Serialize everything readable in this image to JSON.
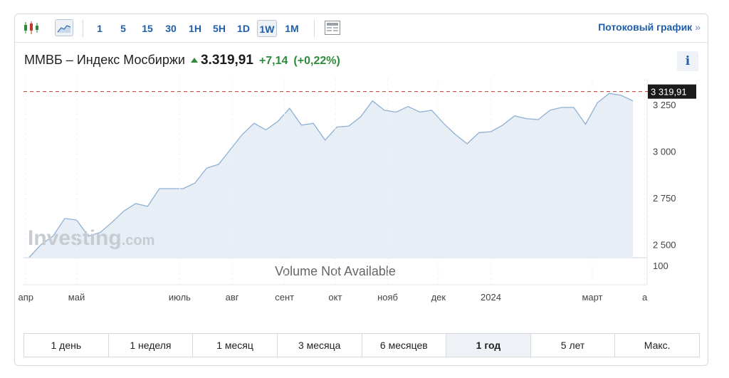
{
  "toolbar": {
    "chart_types": [
      {
        "icon": "candlestick-icon",
        "selected": false
      },
      {
        "icon": "area-chart-icon",
        "selected": true
      }
    ],
    "intervals": [
      {
        "label": "1",
        "selected": false
      },
      {
        "label": "5",
        "selected": false
      },
      {
        "label": "15",
        "selected": false
      },
      {
        "label": "30",
        "selected": false
      },
      {
        "label": "1H",
        "selected": false
      },
      {
        "label": "5H",
        "selected": false
      },
      {
        "label": "1D",
        "selected": false
      },
      {
        "label": "1W",
        "selected": true
      },
      {
        "label": "1M",
        "selected": false
      }
    ],
    "table_icon": "data-table-icon",
    "stream_link": "Потоковый график",
    "stream_chevron": "»"
  },
  "instrument": {
    "name": "ММВБ – Индекс Мосбиржи",
    "price": "3.319,91",
    "change": "+7,14",
    "change_pct": "(+0,22%)",
    "direction_icon": "arrow-up-icon",
    "info_label": "i"
  },
  "chart_data": {
    "type": "area",
    "x": [
      "2023-04-03",
      "2023-04-10",
      "2023-04-17",
      "2023-04-24",
      "2023-05-01",
      "2023-05-08",
      "2023-05-15",
      "2023-05-22",
      "2023-05-29",
      "2023-06-05",
      "2023-06-12",
      "2023-06-19",
      "2023-06-26",
      "2023-07-03",
      "2023-07-10",
      "2023-07-17",
      "2023-07-24",
      "2023-07-31",
      "2023-08-07",
      "2023-08-14",
      "2023-08-21",
      "2023-08-28",
      "2023-09-04",
      "2023-09-11",
      "2023-09-18",
      "2023-09-25",
      "2023-10-02",
      "2023-10-09",
      "2023-10-16",
      "2023-10-23",
      "2023-10-30",
      "2023-11-06",
      "2023-11-13",
      "2023-11-20",
      "2023-11-27",
      "2023-12-04",
      "2023-12-11",
      "2023-12-18",
      "2023-12-25",
      "2024-01-01",
      "2024-01-08",
      "2024-01-15",
      "2024-01-22",
      "2024-01-29",
      "2024-02-05",
      "2024-02-12",
      "2024-02-19",
      "2024-02-26",
      "2024-03-04",
      "2024-03-11",
      "2024-03-18",
      "2024-03-25"
    ],
    "values": [
      2432,
      2500,
      2545,
      2640,
      2632,
      2545,
      2565,
      2620,
      2680,
      2720,
      2705,
      2800,
      2800,
      2800,
      2830,
      2910,
      2930,
      3010,
      3090,
      3150,
      3115,
      3160,
      3230,
      3140,
      3150,
      3060,
      3130,
      3135,
      3185,
      3270,
      3220,
      3210,
      3240,
      3210,
      3220,
      3150,
      3090,
      3040,
      3100,
      3105,
      3140,
      3190,
      3175,
      3170,
      3220,
      3235,
      3235,
      3145,
      3260,
      3310,
      3300,
      3270,
      3320
    ],
    "ylim": [
      2430,
      3330
    ],
    "y_ticks": [
      "2 500",
      "2 750",
      "3 000",
      "3 250"
    ],
    "y_tick_values": [
      2500,
      2750,
      3000,
      3250
    ],
    "x_tick_labels": [
      "апр",
      "май",
      "июль",
      "авг",
      "сент",
      "окт",
      "нояб",
      "дек",
      "2024",
      "март",
      "а"
    ],
    "last_value": 3319.91,
    "last_label": "3 319,91",
    "volume_label": "Volume Not Available",
    "volume_tick": "100",
    "line_color": "#8fb0d4",
    "fill_color": "#e7eef6",
    "ref_line_color": "#c0392b",
    "watermark_bold": "Investing",
    "watermark_light": ".com"
  },
  "periods": [
    {
      "label": "1 день",
      "active": false
    },
    {
      "label": "1 неделя",
      "active": false
    },
    {
      "label": "1 месяц",
      "active": false
    },
    {
      "label": "3 месяца",
      "active": false
    },
    {
      "label": "6 месяцев",
      "active": false
    },
    {
      "label": "1 год",
      "active": true
    },
    {
      "label": "5 лет",
      "active": false
    },
    {
      "label": "Макс.",
      "active": false
    }
  ]
}
